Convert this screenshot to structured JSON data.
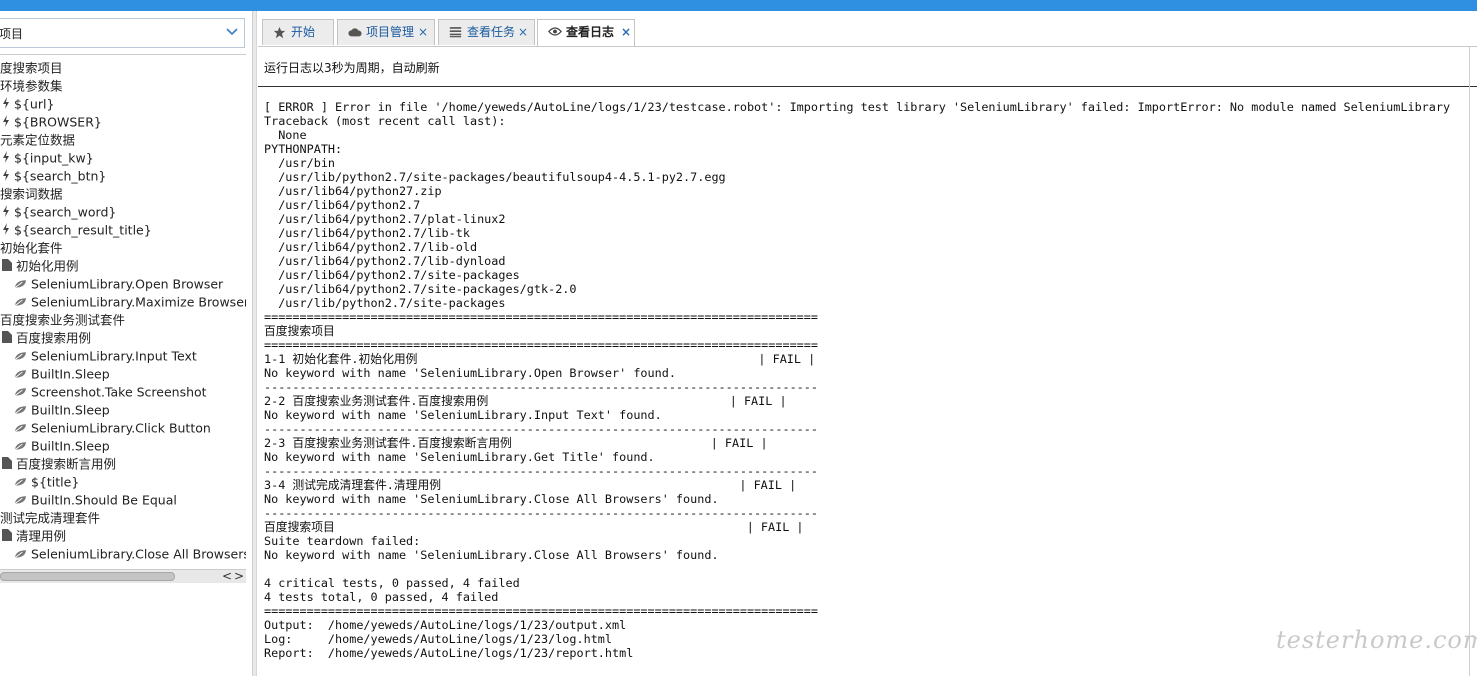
{
  "left_panel": {
    "project_select_value": "项目",
    "tree": [
      {
        "label": "度搜索项目",
        "icon": "none"
      },
      {
        "label": "环境参数集",
        "icon": "none"
      },
      {
        "label": "${url}",
        "icon": "variable-icon"
      },
      {
        "label": "${BROWSER}",
        "icon": "variable-icon"
      },
      {
        "label": "元素定位数据",
        "icon": "none"
      },
      {
        "label": "${input_kw}",
        "icon": "variable-icon"
      },
      {
        "label": "${search_btn}",
        "icon": "variable-icon"
      },
      {
        "label": "搜索词数据",
        "icon": "none"
      },
      {
        "label": "${search_word}",
        "icon": "variable-icon"
      },
      {
        "label": "${search_result_title}",
        "icon": "variable-icon"
      },
      {
        "label": "初始化套件",
        "icon": "none"
      },
      {
        "label": "初始化用例",
        "icon": "testcase-icon"
      },
      {
        "label": "SeleniumLibrary.Open Browser",
        "icon": "keyword-leaf-icon"
      },
      {
        "label": "SeleniumLibrary.Maximize Browser Window",
        "icon": "keyword-leaf-icon"
      },
      {
        "label": "百度搜索业务测试套件",
        "icon": "none"
      },
      {
        "label": "百度搜索用例",
        "icon": "testcase-icon"
      },
      {
        "label": "SeleniumLibrary.Input Text",
        "icon": "keyword-leaf-icon"
      },
      {
        "label": "BuiltIn.Sleep",
        "icon": "keyword-leaf-icon"
      },
      {
        "label": "Screenshot.Take Screenshot",
        "icon": "keyword-leaf-icon"
      },
      {
        "label": "BuiltIn.Sleep",
        "icon": "keyword-leaf-icon"
      },
      {
        "label": "SeleniumLibrary.Click Button",
        "icon": "keyword-leaf-icon"
      },
      {
        "label": "BuiltIn.Sleep",
        "icon": "keyword-leaf-icon"
      },
      {
        "label": "百度搜索断言用例",
        "icon": "testcase-icon"
      },
      {
        "label": "${title}",
        "icon": "keyword-leaf-icon"
      },
      {
        "label": "BuiltIn.Should Be Equal",
        "icon": "keyword-leaf-icon"
      },
      {
        "label": "测试完成清理套件",
        "icon": "none"
      },
      {
        "label": "清理用例",
        "icon": "testcase-icon"
      },
      {
        "label": "SeleniumLibrary.Close All Browsers",
        "icon": "keyword-leaf-icon"
      }
    ],
    "scroll_left": "<",
    "scroll_right": ">"
  },
  "tabs": [
    {
      "label": "开始",
      "icon": "star-icon",
      "closable": false,
      "active": false
    },
    {
      "label": "项目管理",
      "icon": "cloud-icon",
      "closable": true,
      "active": false
    },
    {
      "label": "查看任务",
      "icon": "list-icon",
      "closable": true,
      "active": false
    },
    {
      "label": "查看日志",
      "icon": "eye-icon",
      "closable": true,
      "active": true
    }
  ],
  "close_glyph": "×",
  "refresh_note": "运行日志以3秒为周期，自动刷新",
  "log_text": "[ ERROR ] Error in file '/home/yeweds/AutoLine/logs/1/23/testcase.robot': Importing test library 'SeleniumLibrary' failed: ImportError: No module named SeleniumLibrary\nTraceback (most recent call last):\n  None\nPYTHONPATH:\n  /usr/bin\n  /usr/lib/python2.7/site-packages/beautifulsoup4-4.5.1-py2.7.egg\n  /usr/lib64/python27.zip\n  /usr/lib64/python2.7\n  /usr/lib64/python2.7/plat-linux2\n  /usr/lib64/python2.7/lib-tk\n  /usr/lib64/python2.7/lib-old\n  /usr/lib64/python2.7/lib-dynload\n  /usr/lib64/python2.7/site-packages\n  /usr/lib64/python2.7/site-packages/gtk-2.0\n  /usr/lib/python2.7/site-packages\n==============================================================================\n百度搜索项目\n==============================================================================\n1-1 初始化套件.初始化用例                                                | FAIL |\nNo keyword with name 'SeleniumLibrary.Open Browser' found.\n------------------------------------------------------------------------------\n2-2 百度搜索业务测试套件.百度搜索用例                                  | FAIL |\nNo keyword with name 'SeleniumLibrary.Input Text' found.\n------------------------------------------------------------------------------\n2-3 百度搜索业务测试套件.百度搜索断言用例                            | FAIL |\nNo keyword with name 'SeleniumLibrary.Get Title' found.\n------------------------------------------------------------------------------\n3-4 测试完成清理套件.清理用例                                          | FAIL |\nNo keyword with name 'SeleniumLibrary.Close All Browsers' found.\n------------------------------------------------------------------------------\n百度搜索项目                                                          | FAIL |\nSuite teardown failed:\nNo keyword with name 'SeleniumLibrary.Close All Browsers' found.\n\n4 critical tests, 0 passed, 4 failed\n4 tests total, 0 passed, 4 failed\n==============================================================================\nOutput:  /home/yeweds/AutoLine/logs/1/23/output.xml\nLog:     /home/yeweds/AutoLine/logs/1/23/log.html\nReport:  /home/yeweds/AutoLine/logs/1/23/report.html",
  "watermark": "testerhome.com",
  "colors": {
    "topbar": "#2f8fe0",
    "tab_link": "#1a5aa0"
  }
}
